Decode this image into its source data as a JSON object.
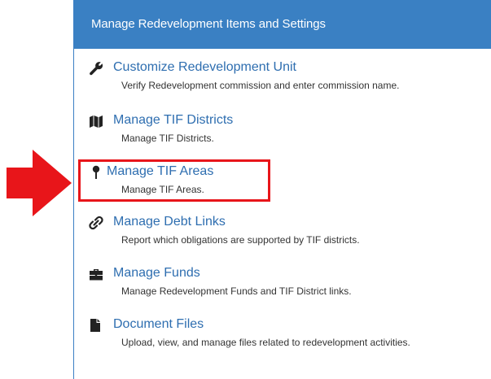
{
  "panel": {
    "title": "Manage Redevelopment Items and Settings"
  },
  "items": [
    {
      "title": "Customize Redevelopment Unit",
      "description": "Verify Redevelopment commission and enter commission name.",
      "icon": "wrench-icon"
    },
    {
      "title": "Manage TIF Districts",
      "description": "Manage TIF Districts.",
      "icon": "map-icon"
    },
    {
      "title": "Manage TIF Areas",
      "description": "Manage TIF Areas.",
      "icon": "map-pin-icon"
    },
    {
      "title": "Manage Debt Links",
      "description": "Report which obligations are supported by TIF districts.",
      "icon": "link-icon"
    },
    {
      "title": "Manage Funds",
      "description": "Manage Redevelopment Funds and TIF District links.",
      "icon": "briefcase-icon"
    },
    {
      "title": "Document Files",
      "description": "Upload, view, and manage files related to redevelopment activities.",
      "icon": "file-icon"
    }
  ],
  "colors": {
    "header_bg": "#3a80c3",
    "link": "#2e6eb0",
    "annotation": "#e8151a"
  }
}
